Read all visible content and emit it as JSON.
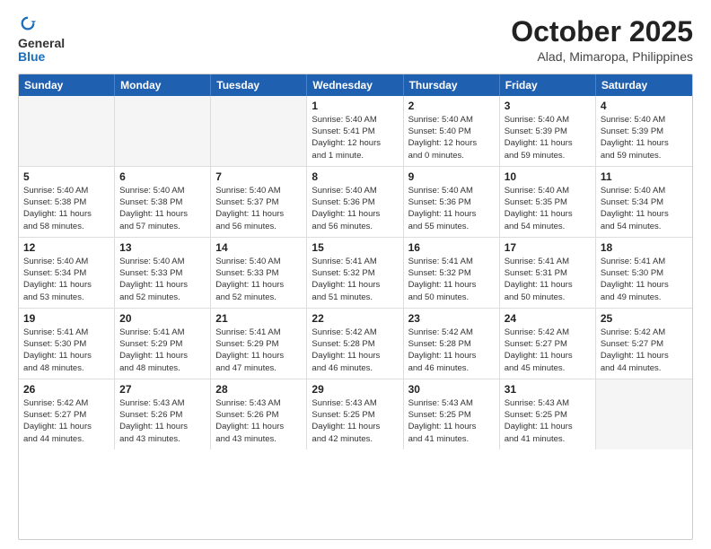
{
  "logo": {
    "general": "General",
    "blue": "Blue"
  },
  "header": {
    "month": "October 2025",
    "location": "Alad, Mimaropa, Philippines"
  },
  "weekdays": [
    "Sunday",
    "Monday",
    "Tuesday",
    "Wednesday",
    "Thursday",
    "Friday",
    "Saturday"
  ],
  "rows": [
    [
      {
        "day": "",
        "info": ""
      },
      {
        "day": "",
        "info": ""
      },
      {
        "day": "",
        "info": ""
      },
      {
        "day": "1",
        "info": "Sunrise: 5:40 AM\nSunset: 5:41 PM\nDaylight: 12 hours\nand 1 minute."
      },
      {
        "day": "2",
        "info": "Sunrise: 5:40 AM\nSunset: 5:40 PM\nDaylight: 12 hours\nand 0 minutes."
      },
      {
        "day": "3",
        "info": "Sunrise: 5:40 AM\nSunset: 5:39 PM\nDaylight: 11 hours\nand 59 minutes."
      },
      {
        "day": "4",
        "info": "Sunrise: 5:40 AM\nSunset: 5:39 PM\nDaylight: 11 hours\nand 59 minutes."
      }
    ],
    [
      {
        "day": "5",
        "info": "Sunrise: 5:40 AM\nSunset: 5:38 PM\nDaylight: 11 hours\nand 58 minutes."
      },
      {
        "day": "6",
        "info": "Sunrise: 5:40 AM\nSunset: 5:38 PM\nDaylight: 11 hours\nand 57 minutes."
      },
      {
        "day": "7",
        "info": "Sunrise: 5:40 AM\nSunset: 5:37 PM\nDaylight: 11 hours\nand 56 minutes."
      },
      {
        "day": "8",
        "info": "Sunrise: 5:40 AM\nSunset: 5:36 PM\nDaylight: 11 hours\nand 56 minutes."
      },
      {
        "day": "9",
        "info": "Sunrise: 5:40 AM\nSunset: 5:36 PM\nDaylight: 11 hours\nand 55 minutes."
      },
      {
        "day": "10",
        "info": "Sunrise: 5:40 AM\nSunset: 5:35 PM\nDaylight: 11 hours\nand 54 minutes."
      },
      {
        "day": "11",
        "info": "Sunrise: 5:40 AM\nSunset: 5:34 PM\nDaylight: 11 hours\nand 54 minutes."
      }
    ],
    [
      {
        "day": "12",
        "info": "Sunrise: 5:40 AM\nSunset: 5:34 PM\nDaylight: 11 hours\nand 53 minutes."
      },
      {
        "day": "13",
        "info": "Sunrise: 5:40 AM\nSunset: 5:33 PM\nDaylight: 11 hours\nand 52 minutes."
      },
      {
        "day": "14",
        "info": "Sunrise: 5:40 AM\nSunset: 5:33 PM\nDaylight: 11 hours\nand 52 minutes."
      },
      {
        "day": "15",
        "info": "Sunrise: 5:41 AM\nSunset: 5:32 PM\nDaylight: 11 hours\nand 51 minutes."
      },
      {
        "day": "16",
        "info": "Sunrise: 5:41 AM\nSunset: 5:32 PM\nDaylight: 11 hours\nand 50 minutes."
      },
      {
        "day": "17",
        "info": "Sunrise: 5:41 AM\nSunset: 5:31 PM\nDaylight: 11 hours\nand 50 minutes."
      },
      {
        "day": "18",
        "info": "Sunrise: 5:41 AM\nSunset: 5:30 PM\nDaylight: 11 hours\nand 49 minutes."
      }
    ],
    [
      {
        "day": "19",
        "info": "Sunrise: 5:41 AM\nSunset: 5:30 PM\nDaylight: 11 hours\nand 48 minutes."
      },
      {
        "day": "20",
        "info": "Sunrise: 5:41 AM\nSunset: 5:29 PM\nDaylight: 11 hours\nand 48 minutes."
      },
      {
        "day": "21",
        "info": "Sunrise: 5:41 AM\nSunset: 5:29 PM\nDaylight: 11 hours\nand 47 minutes."
      },
      {
        "day": "22",
        "info": "Sunrise: 5:42 AM\nSunset: 5:28 PM\nDaylight: 11 hours\nand 46 minutes."
      },
      {
        "day": "23",
        "info": "Sunrise: 5:42 AM\nSunset: 5:28 PM\nDaylight: 11 hours\nand 46 minutes."
      },
      {
        "day": "24",
        "info": "Sunrise: 5:42 AM\nSunset: 5:27 PM\nDaylight: 11 hours\nand 45 minutes."
      },
      {
        "day": "25",
        "info": "Sunrise: 5:42 AM\nSunset: 5:27 PM\nDaylight: 11 hours\nand 44 minutes."
      }
    ],
    [
      {
        "day": "26",
        "info": "Sunrise: 5:42 AM\nSunset: 5:27 PM\nDaylight: 11 hours\nand 44 minutes."
      },
      {
        "day": "27",
        "info": "Sunrise: 5:43 AM\nSunset: 5:26 PM\nDaylight: 11 hours\nand 43 minutes."
      },
      {
        "day": "28",
        "info": "Sunrise: 5:43 AM\nSunset: 5:26 PM\nDaylight: 11 hours\nand 43 minutes."
      },
      {
        "day": "29",
        "info": "Sunrise: 5:43 AM\nSunset: 5:25 PM\nDaylight: 11 hours\nand 42 minutes."
      },
      {
        "day": "30",
        "info": "Sunrise: 5:43 AM\nSunset: 5:25 PM\nDaylight: 11 hours\nand 41 minutes."
      },
      {
        "day": "31",
        "info": "Sunrise: 5:43 AM\nSunset: 5:25 PM\nDaylight: 11 hours\nand 41 minutes."
      },
      {
        "day": "",
        "info": ""
      }
    ]
  ]
}
